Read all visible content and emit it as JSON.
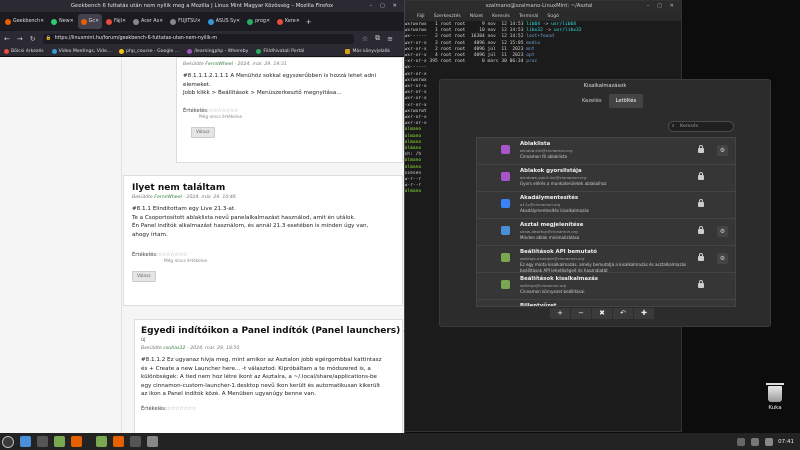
{
  "desktop": {
    "trash_label": "Kuka"
  },
  "terminal": {
    "title": "szalmano@szalmano-LinuxMint: ~/Asztal",
    "menu": [
      "Fájl",
      "Szerkesztés",
      "Nézet",
      "Keresés",
      "Terminál",
      "Súgó"
    ],
    "lines": [
      [
        [
          "lrwxrwxrwx   1 root root      9 nov  12 14:53 ",
          ""
        ],
        [
          "lib64",
          "t-c"
        ],
        [
          " -> ",
          ""
        ],
        [
          "usr/lib64",
          "t-c"
        ]
      ],
      [
        [
          "lrwxrwxrwx   1 root root     10 nov  12 14:53 ",
          ""
        ],
        [
          "libx32",
          "t-c"
        ],
        [
          " -> ",
          ""
        ],
        [
          "usr/libx32",
          "t-c"
        ]
      ],
      [
        [
          "drwx------   2 root root  16384 nov  12 14:52 ",
          ""
        ],
        [
          "lost+found",
          "t-b"
        ]
      ],
      [
        [
          "drwxr-xr-x   3 root root   4096 nov  12 15:05 ",
          ""
        ],
        [
          "media",
          "t-b"
        ]
      ],
      [
        [
          "drwxr-xr-x   2 root root   4096 júl  11  2023 ",
          ""
        ],
        [
          "mnt",
          "t-b"
        ]
      ],
      [
        [
          "drwxr-xr-x   4 root root   4096 júl  11  2023 ",
          ""
        ],
        [
          "opt",
          "t-b"
        ]
      ],
      [
        [
          "dr-xr-xr-x 395 root root      0 márc 30 06:34 ",
          ""
        ],
        [
          "proc",
          "t-b"
        ]
      ],
      [
        [
          "drwx------",
          ""
        ]
      ],
      [
        [
          "drwxr-xr-x",
          ""
        ]
      ],
      [
        [
          "lrwxrwxrwx",
          ""
        ]
      ],
      [
        [
          "drwxr-xr-x",
          ""
        ]
      ],
      [
        [
          "drwxr-xr-x",
          ""
        ]
      ],
      [
        [
          "drwxr-xr-x",
          ""
        ]
      ],
      [
        [
          "dr-xr-xr-x",
          ""
        ]
      ],
      [
        [
          "drwxrwxrwt",
          ""
        ]
      ],
      [
        [
          "drwxr-xr-x",
          ""
        ]
      ],
      [
        [
          "drwxr-xr-x",
          ""
        ]
      ],
      [
        [
          "szalmano",
          "t-g"
        ]
      ],
      [
        [
          "szalmano",
          "t-g"
        ]
      ],
      [
        [
          "szalmano",
          "t-g"
        ]
      ],
      [
        [
          "szalmano",
          "t-g"
        ]
      ],
      [
        [
          "bash: /h",
          ""
        ]
      ],
      [
        [
          "szalmano",
          "t-g"
        ]
      ],
      [
        [
          "szalmano",
          "t-g"
        ]
      ],
      [
        [
          "összesen",
          ""
        ]
      ],
      [
        [
          "-rw-r--r",
          ""
        ]
      ],
      [
        [
          "-rw-r--r",
          ""
        ]
      ],
      [
        [
          "szalmano",
          "t-g"
        ]
      ]
    ]
  },
  "firefox": {
    "title": "Geekbench 6 futtatás után nem nyílik meg a Mozilla | Linux Mint Magyar Közösség – Mozilla Firefox",
    "tabs": [
      {
        "label": "Geekbench",
        "color": "#e66000",
        "active": false
      },
      {
        "label": "New",
        "color": "#2ecc71",
        "active": false
      },
      {
        "label": "Gc",
        "color": "#e66000",
        "active": true
      },
      {
        "label": "Fájl",
        "color": "#e74c3c",
        "active": false
      },
      {
        "label": "Acer As",
        "color": "#888888",
        "active": false
      },
      {
        "label": "FUJITSU",
        "color": "#888888",
        "active": false
      },
      {
        "label": "ASUS Sy",
        "color": "#3498db",
        "active": false
      },
      {
        "label": "prog",
        "color": "#27ae60",
        "active": false
      },
      {
        "label": "Kere",
        "color": "#e74c3c",
        "active": false
      }
    ],
    "url": "https://linuxmint.hu/forum/geekbench-6-futtatas-utan-nem-nyilik-m",
    "bookmarks": [
      {
        "label": "Bölcsi érkezés",
        "color": "#e74c3c"
      },
      {
        "label": "Video Meetings, Vide...",
        "color": "#3498db"
      },
      {
        "label": "php_course - Google ...",
        "color": "#f1c40f"
      },
      {
        "label": "/learningphp - Whereby",
        "color": "#9b59b6"
      },
      {
        "label": "Földhivatali Portál",
        "color": "#27ae60"
      }
    ],
    "bookmarks_more": "Más könyvjelzők",
    "posts": [
      {
        "meta_prefix": "Beküldte ",
        "author": "FernsWheel",
        "date": " - 2024. már. 29. 19:31",
        "lines": [
          "#8.1.1.1.2.1.1.1 A Menühöz sokkal egyszerűbben is hozzá lehet adni",
          "elemeket.",
          "Jobb klikk > Beállítások > Menüszerkesztő megnyitása..."
        ],
        "rating_label": "Értékelés:",
        "stars": "☆☆☆☆☆☆☆",
        "rating_note": "Még nincs értékelve",
        "vote": "Válasz"
      },
      {
        "title": "Ilyet nem találtam",
        "meta_prefix": "Beküldte ",
        "author": "FernsWheel",
        "date": " - 2024. már. 29. 10:46",
        "lines": [
          "#8.1.1 Elinditottam egy Live 21.3-at.",
          "Te a Csoportosított ablaklista nevű panelalkalmazást használod, amit én utálok.",
          "Én Panel indítók alkalmazást használom, és annál 21.3 esetében is minden úgy van,",
          "ahogy írtam."
        ],
        "rating_label": "Értékelés:",
        "stars": "☆☆☆☆☆☆☆",
        "rating_note": "Még nincs értékelve",
        "vote": "Válasz"
      },
      {
        "title": "Egyedi indítóikon a Panel indítók (Panel launchers) által",
        "subtitle": "új",
        "meta_prefix": "Beküldte ",
        "author": "csuhas32",
        "date": " - 2024. már. 29. 18:50",
        "lines": [
          "#8.1.1.2 Ez ugyanaz hívja meg, mint amikor az Asztalon jobb egérgombbal kattintasz",
          "és + Create a new Launcher here... -t választod. Kipróbáltam a te módszered is, a",
          "különbségek: A tied nem hoz létre ikont az Asztalra, a ~/.local/share/applications-be",
          "egy cinnamon-custom-launcher-1.desktop nevű ikon került és automatikusan kikerült",
          "az ikon a Panel indítók közé. A Menüben ugyanúgy benne van."
        ],
        "rating_label": "Értékelés:",
        "stars": "☆☆☆☆☆☆☆"
      }
    ]
  },
  "dialog": {
    "title": "Kisalkalmazások",
    "tabs": [
      "Kezelés",
      "Letöltés"
    ],
    "search_placeholder": "Keresés",
    "applets": [
      {
        "name": "Ablaklista",
        "id": "window-list@cinnamon.org",
        "desc": [
          "Cinnamon fő ablaklista"
        ],
        "color": "#a855c9",
        "configurable": true
      },
      {
        "name": "Ablakok gyorslistája",
        "id": "windows-quick-list@cinnamon.org",
        "desc": [
          "Gyors elérés a munkaterületek ablakaihoz"
        ],
        "color": "#a855c9",
        "configurable": false
      },
      {
        "name": "Akadálymentesítés",
        "id": "a11y@cinnamon.org",
        "desc": [
          "Akadálymentesítés kisalkalmazás"
        ],
        "color": "#3b82f6",
        "configurable": false
      },
      {
        "name": "Asztal megjelenítése",
        "id": "show-desktop@cinnamon.org",
        "desc": [
          "Minden ablak minimalizálása"
        ],
        "color": "#4a90d9",
        "configurable": true
      },
      {
        "name": "Beállítások API bemutató",
        "id": "settings-example@cinnamon.org",
        "desc": [
          "Ez egy minta kisalkalmazás, amely bemutatja a kisalkalmazás és asztalkalmazás",
          "beállítások API lehetőségeit és használatát"
        ],
        "color": "#7aa850",
        "configurable": true
      },
      {
        "name": "Beállítások kisalkalmazás",
        "id": "settings@cinnamon.org",
        "desc": [
          "Cinnamon környezet beállításai"
        ],
        "color": "#7aa850",
        "configurable": false
      },
      {
        "name": "Billentyűzet",
        "id": "",
        "desc": [
          ""
        ],
        "color": "#888888",
        "configurable": false
      }
    ],
    "toolbar": [
      "+",
      "−",
      "✖",
      "↶",
      "✚"
    ]
  },
  "panel": {
    "icons": [
      {
        "name": "menu-icon",
        "color": "#3a3a3a"
      },
      {
        "name": "show-desktop-icon",
        "color": "#4a90d9"
      },
      {
        "name": "terminal-icon",
        "color": "#555555"
      },
      {
        "name": "files-icon",
        "color": "#7aa850"
      },
      {
        "name": "firefox-icon",
        "color": "#e66000"
      },
      {
        "name": "files-window-icon",
        "color": "#7aa850"
      },
      {
        "name": "firefox-window-icon",
        "color": "#e66000"
      },
      {
        "name": "terminal-window-icon",
        "color": "#555555"
      },
      {
        "name": "settings-window-icon",
        "color": "#888888"
      }
    ],
    "clock": "07:41"
  }
}
